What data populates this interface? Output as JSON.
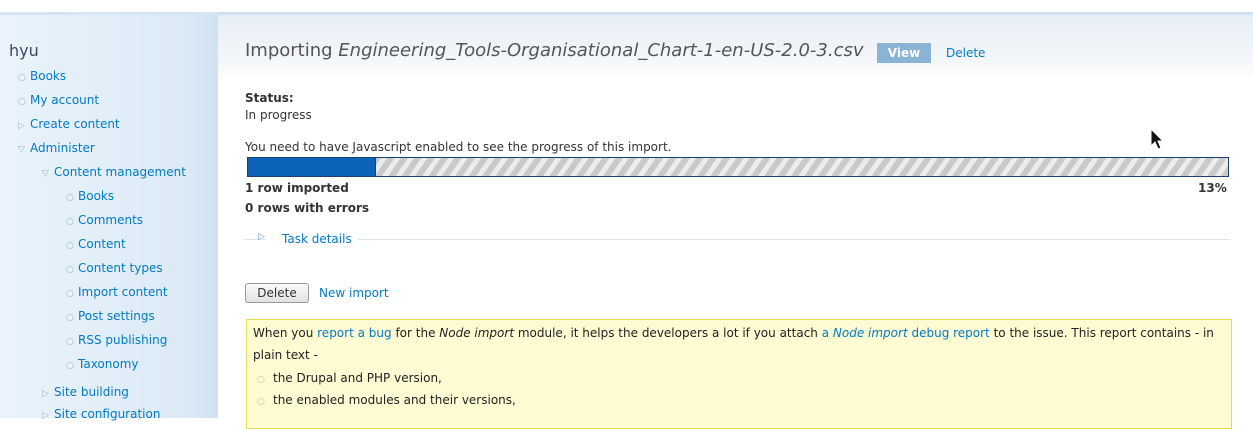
{
  "sidebar": {
    "username": "hyu",
    "items": [
      {
        "label": "Books",
        "level": 0,
        "bullet": "○"
      },
      {
        "label": "My account",
        "level": 0,
        "bullet": "○"
      },
      {
        "label": "Create content",
        "level": 0,
        "bullet": "▷"
      },
      {
        "label": "Administer",
        "level": 0,
        "bullet": "▽"
      },
      {
        "label": "Content management",
        "level": 1,
        "bullet": "▽"
      },
      {
        "label": "Books",
        "level": 2,
        "bullet": "○"
      },
      {
        "label": "Comments",
        "level": 2,
        "bullet": "○"
      },
      {
        "label": "Content",
        "level": 2,
        "bullet": "○"
      },
      {
        "label": "Content types",
        "level": 2,
        "bullet": "○"
      },
      {
        "label": "Import content",
        "level": 2,
        "bullet": "○"
      },
      {
        "label": "Post settings",
        "level": 2,
        "bullet": "○"
      },
      {
        "label": "RSS publishing",
        "level": 2,
        "bullet": "○"
      },
      {
        "label": "Taxonomy",
        "level": 2,
        "bullet": "○"
      },
      {
        "label": "Site building",
        "level": 1,
        "bullet": "▷"
      },
      {
        "label": "Site configuration",
        "level": 1,
        "bullet": "▷"
      }
    ]
  },
  "header": {
    "title_prefix": "Importing ",
    "title_file": "Engineering_Tools-Organisational_Chart-1-en-US-2.0-3.csv",
    "tab_view": "View",
    "tab_delete": "Delete"
  },
  "status": {
    "label": "Status:",
    "value": "In progress",
    "js_notice": "You need to have Javascript enabled to see the progress of this import.",
    "progress_percent": 13,
    "progress_text": "13%",
    "rows_imported": "1 row imported",
    "rows_errors": "0 rows with errors",
    "task_details": "Task details"
  },
  "actions": {
    "delete_button": "Delete",
    "new_import": "New import"
  },
  "notice": {
    "t1": "When you ",
    "link1": "report a bug",
    "t2": " for the ",
    "em1": "Node import",
    "t3": " module, it helps the developers a lot if you attach ",
    "link2a": "a ",
    "link2b": "Node import",
    "link2c": " debug report",
    "t4": " to the issue. This report contains - in plain text -",
    "items": [
      "the Drupal and PHP version,",
      "the enabled modules and their versions,"
    ]
  },
  "colors": {
    "link": "#027ac6",
    "progress_fill": "#0a63b6",
    "notice_bg": "#fffbd2"
  }
}
